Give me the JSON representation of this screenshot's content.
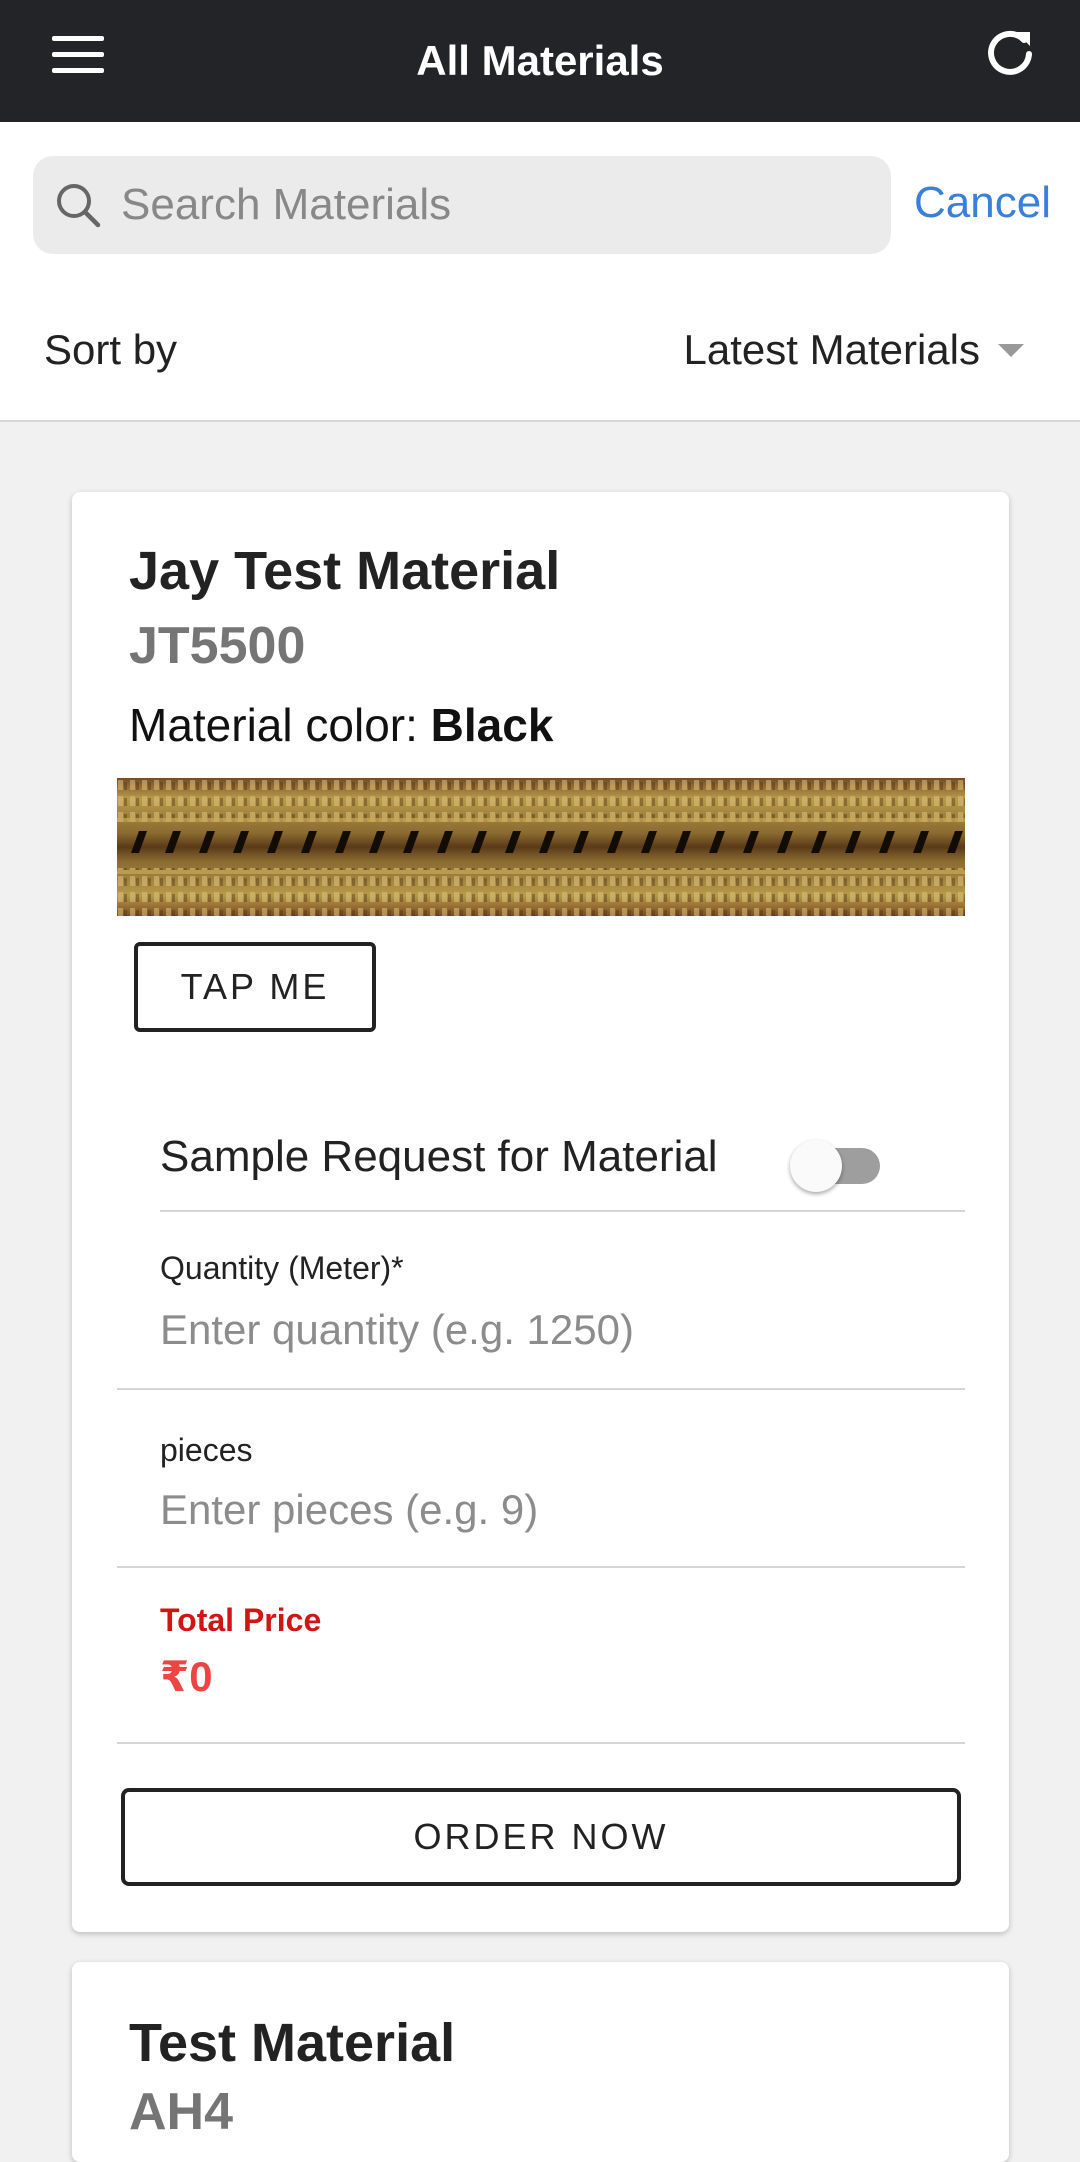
{
  "header": {
    "title": "All Materials",
    "menu_icon": "hamburger-menu-icon",
    "refresh_icon": "refresh-icon"
  },
  "search": {
    "placeholder": "Search Materials",
    "value": "",
    "cancel_label": "Cancel",
    "icon": "search-icon"
  },
  "sort": {
    "label": "Sort by",
    "selected": "Latest Materials"
  },
  "materials": [
    {
      "name": "Jay Test Material",
      "code": "JT5500",
      "color_label": "Material color: ",
      "color_value": "Black",
      "tap_label": "TAP ME",
      "sample_label": "Sample Request for Material",
      "sample_enabled": false,
      "quantity_label": "Quantity (Meter)*",
      "quantity_placeholder": "Enter quantity (e.g. 1250)",
      "pieces_label": "pieces",
      "pieces_placeholder": "Enter pieces (e.g. 9)",
      "price_label": "Total Price",
      "price_value": "₹0",
      "order_label": "ORDER NOW"
    },
    {
      "name": "Test Material",
      "code": "AH4"
    }
  ],
  "colors": {
    "header_bg": "#222428",
    "accent": "#3880d9",
    "price_label": "#d11414",
    "price_value": "#ee4444"
  }
}
